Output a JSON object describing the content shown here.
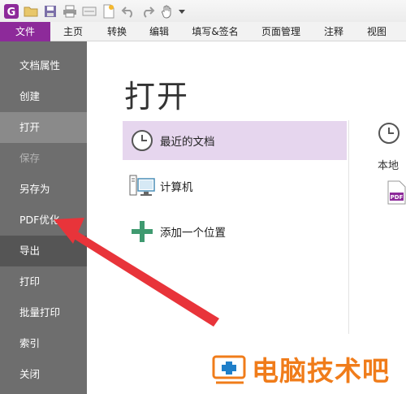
{
  "ribbon": {
    "tabs": [
      "文件",
      "主页",
      "转换",
      "编辑",
      "填写&签名",
      "页面管理",
      "注释",
      "视图"
    ]
  },
  "sidebar": {
    "items": [
      {
        "label": "文档属性",
        "state": "normal"
      },
      {
        "label": "创建",
        "state": "normal"
      },
      {
        "label": "打开",
        "state": "selected"
      },
      {
        "label": "保存",
        "state": "disabled"
      },
      {
        "label": "另存为",
        "state": "normal"
      },
      {
        "label": "PDF优化",
        "state": "normal"
      },
      {
        "label": "导出",
        "state": "highlight"
      },
      {
        "label": "打印",
        "state": "normal"
      },
      {
        "label": "批量打印",
        "state": "normal"
      },
      {
        "label": "索引",
        "state": "normal"
      },
      {
        "label": "关闭",
        "state": "normal"
      }
    ]
  },
  "main": {
    "title": "打开",
    "locations": [
      {
        "label": "最近的文档",
        "icon": "clock-icon",
        "selected": true
      },
      {
        "label": "计算机",
        "icon": "computer-icon",
        "selected": false
      },
      {
        "label": "添加一个位置",
        "icon": "plus-icon",
        "selected": false
      }
    ],
    "right_pane": {
      "label": "本地",
      "file_icon_text": "PDF"
    }
  },
  "watermark": {
    "text": "电脑技术吧"
  },
  "colors": {
    "file_tab": "#8d2a9a",
    "sidebar_bg": "#6e6e6e",
    "selected_location": "#e6d6ee",
    "arrow": "#e8343a",
    "watermark": "#f07c1a"
  }
}
